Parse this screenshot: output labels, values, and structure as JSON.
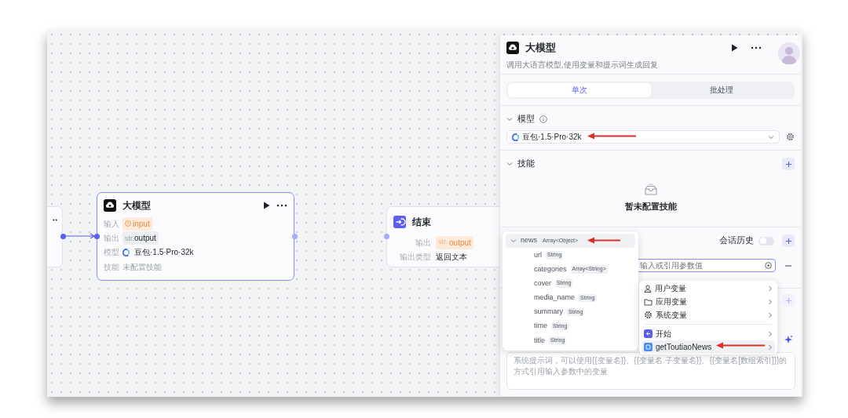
{
  "canvas": {
    "nodes": [
      {
        "kind": "llm",
        "title": "大模型",
        "selected": true,
        "rows": [
          {
            "label": "输入",
            "kind": "warning",
            "value": "input"
          },
          {
            "label": "输出",
            "kind": "type",
            "prefix": "str.",
            "value": "output"
          },
          {
            "label": "模型",
            "kind": "model",
            "value": "豆包·1.5·Pro·32k"
          },
          {
            "label": "技能",
            "kind": "muted",
            "value": "未配置技能"
          }
        ]
      },
      {
        "kind": "end",
        "title": "结束",
        "selected": false,
        "rows": [
          {
            "label": "输出",
            "kind": "type-warning",
            "prefix": "str.",
            "value": "output"
          },
          {
            "label": "输出类型",
            "kind": "text",
            "value": "返回文本"
          }
        ]
      }
    ]
  },
  "panel": {
    "title": "大模型",
    "description": "调用大语言模型,使用变量和提示词生成回复",
    "tabs": [
      {
        "label": "单次",
        "selected": true
      },
      {
        "label": "批处理",
        "selected": false
      }
    ],
    "model_section": {
      "title": "模型",
      "expanded": true,
      "model": "豆包·1.5·Pro·32k"
    },
    "skills_section": {
      "title": "技能",
      "expanded": true,
      "empty_text": "暂未配置技能"
    },
    "history": {
      "label": "会话历史",
      "on": false
    },
    "input_field": {
      "placeholder": "输入或引用参数值"
    },
    "section_4": {
      "add_disabled": true
    },
    "prompt": {
      "placeholder": "系统提示词，可以使用{{变量名}}、{{变量名.子变量名}}、{{变量名[数组索引]}}的方式引用输入参数中的变量"
    }
  },
  "variable_menu": {
    "groups": [
      {
        "items": [
          {
            "kind": "user",
            "label": "用户变量",
            "selected": false
          },
          {
            "kind": "folder",
            "label": "应用变量",
            "selected": false
          },
          {
            "kind": "system",
            "label": "系统变量",
            "selected": false
          }
        ]
      },
      {
        "items": [
          {
            "kind": "start",
            "label": "开始",
            "selected": false
          },
          {
            "kind": "plugin",
            "label": "getToutiaoNews",
            "selected": true
          }
        ]
      }
    ]
  },
  "field_tree": [
    {
      "name": "news",
      "type": "Array<Object>",
      "expanded": true,
      "selected": true,
      "children": [
        {
          "name": "url",
          "type": "String",
          "selected": false
        },
        {
          "name": "categories",
          "type": "Array<String>",
          "selected": false
        },
        {
          "name": "cover",
          "type": "String",
          "selected": false
        },
        {
          "name": "media_name",
          "type": "String",
          "selected": false
        },
        {
          "name": "summary",
          "type": "String",
          "selected": false
        },
        {
          "name": "time",
          "type": "String",
          "selected": false
        },
        {
          "name": "title",
          "type": "String",
          "selected": false
        }
      ]
    }
  ]
}
